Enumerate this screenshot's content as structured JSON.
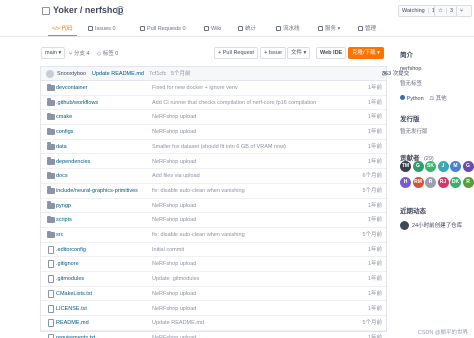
{
  "header": {
    "title": "Yoker / nerfshop",
    "watching_label": "Watching",
    "watching_count": "1",
    "star_label": "Star",
    "star_count": "3",
    "fork_label": "Fork",
    "fork_count": "0"
  },
  "tabs": [
    {
      "label": "代码",
      "icon": "code-icon"
    },
    {
      "label": "Issues",
      "count": "0"
    },
    {
      "label": "Pull Requests",
      "count": "0"
    },
    {
      "label": "Wiki"
    },
    {
      "label": "统计"
    },
    {
      "label": "流水线"
    },
    {
      "label": "服务"
    },
    {
      "label": "管理"
    }
  ],
  "toolbar": {
    "branch": "main",
    "branches_label": "分支 4",
    "tags_label": "标签 0",
    "pull_request_label": "+ Pull Request",
    "issue_label": "+ Issue",
    "file_label": "文件",
    "web_ide_label": "Web IDE",
    "clone_label": "克隆/下载"
  },
  "latest_commit": {
    "author": "Snooxtyboo",
    "message": "Update README.md",
    "hash": "7cf1cfc",
    "time": "5个月前",
    "count": "363 次提交"
  },
  "files": [
    {
      "name": "devcontainer",
      "type": "folder",
      "message": "Fixed for new docker + ignore venv",
      "time": "1年前"
    },
    {
      "name": ".github/workflows",
      "type": "folder",
      "message": "Add CI runner that checks compilation of nerf-core fp16 compilation",
      "time": "1年前"
    },
    {
      "name": "cmake",
      "type": "folder",
      "message": "NeRFshop upload",
      "time": "1年前"
    },
    {
      "name": "configs",
      "type": "folder",
      "message": "NeRFshop upload",
      "time": "1年前"
    },
    {
      "name": "data",
      "type": "folder",
      "message": "Smaller fox dataset (should fit into 6 GB of VRAM now)",
      "time": "1年前"
    },
    {
      "name": "dependencies",
      "type": "folder",
      "message": "NeRFshop upload",
      "time": "1年前"
    },
    {
      "name": "docs",
      "type": "folder",
      "message": "Add files via upload",
      "time": "6个月前"
    },
    {
      "name": "include/neural-graphics-primitives",
      "type": "folder",
      "message": "fix: disable auto-clean when vanishing",
      "time": "5个月前"
    },
    {
      "name": "pyngp",
      "type": "folder",
      "message": "NeRFshop upload",
      "time": "1年前"
    },
    {
      "name": "scripts",
      "type": "folder",
      "message": "NeRFshop upload",
      "time": "1年前"
    },
    {
      "name": "src",
      "type": "folder",
      "message": "fix: disable auto-clean when vanishing",
      "time": "5个月前"
    },
    {
      "name": ".editorconfig",
      "type": "file",
      "message": "Initial commit",
      "time": "1年前"
    },
    {
      "name": ".gitignore",
      "type": "file",
      "message": "NeRFshop upload",
      "time": "1年前"
    },
    {
      "name": ".gitmodules",
      "type": "file",
      "message": "Update .gitmodules",
      "time": "1年前"
    },
    {
      "name": "CMakeLists.txt",
      "type": "file",
      "message": "NeRFshop upload",
      "time": "1年前"
    },
    {
      "name": "LICENSE.txt",
      "type": "file",
      "message": "NeRFshop upload",
      "time": "1年前"
    },
    {
      "name": "README.md",
      "type": "file",
      "message": "Update README.md",
      "time": "5个月前"
    },
    {
      "name": "requirements.txt",
      "type": "file",
      "message": "NeRFshop upload",
      "time": "1年前"
    }
  ],
  "sidebar": {
    "intro_title": "简介",
    "repo_name": "nerfshop",
    "no_tags": "暂无标签",
    "language": "Python",
    "language_color": "#3572a5",
    "license": "其他",
    "releases_title": "发行版",
    "releases_text": "暂无发行版",
    "contributors_title": "贡献者",
    "contributors_count": "(29)",
    "contributors": [
      {
        "initials": "TM",
        "color": "#3a3f4a"
      },
      {
        "initials": "G",
        "color": "#2e9e6b"
      },
      {
        "initials": "SK",
        "color": "#39b56a"
      },
      {
        "initials": "J",
        "color": "#3aa8b0"
      },
      {
        "initials": "M",
        "color": "#4a7fd1"
      },
      {
        "initials": "G",
        "color": "#6b4aa8"
      },
      {
        "initials": "H",
        "color": "#7b5ad0"
      },
      {
        "initials": "RM",
        "color": "#d0533a"
      },
      {
        "initials": "R",
        "color": "#9aa0ae"
      },
      {
        "initials": "RJ",
        "color": "#d03a6b"
      },
      {
        "initials": "DK",
        "color": "#3ab06e"
      },
      {
        "initials": "R",
        "color": "#5a9e3a"
      }
    ],
    "activity_title": "近期动态",
    "activity_text": "24小时前创建了仓库"
  },
  "watermark": "CSDN @躺平的世界"
}
